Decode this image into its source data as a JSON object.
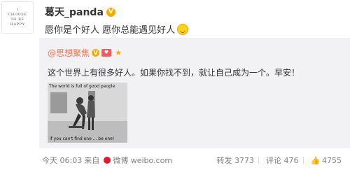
{
  "avatar": {
    "lines": [
      "I",
      "CHOOSE",
      "TO BE",
      "HAPPY"
    ]
  },
  "post": {
    "author": "葛天_panda",
    "verified_mark": "V",
    "text": "愿你是个好人 愿你总能遇见好人"
  },
  "repost": {
    "author": "@思想聚焦",
    "verified_mark": "V",
    "text": "这个世界上有很多好人。如果你找不到，就让自己成为一个。早安！",
    "image": {
      "caption_top": "The world is full of good people",
      "caption_bottom": "if you can't find one ... be one!"
    }
  },
  "footer": {
    "time": "今天 06:03",
    "source_prefix": "来自",
    "source": "微博 weibo.com"
  },
  "actions": {
    "repost_label": "转发 3773",
    "comment_label": "评论 476",
    "like_count": "4755"
  },
  "colors": {
    "author_link": "#eb7350",
    "repost_bg": "#f2f2f5",
    "badge": "#f6ab00"
  }
}
